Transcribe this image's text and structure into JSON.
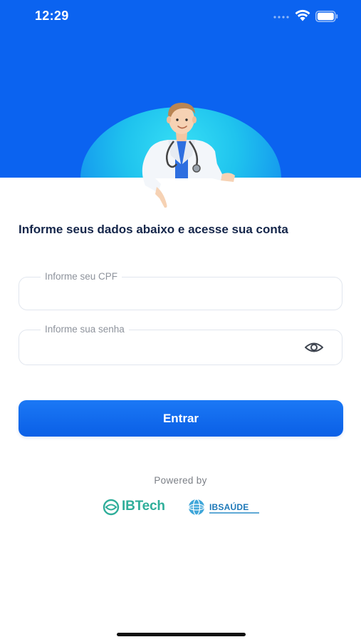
{
  "status_bar": {
    "time": "12:29"
  },
  "login": {
    "headline": "Informe seus dados abaixo e acesse sua conta",
    "cpf_label": "Informe seu CPF",
    "cpf_value": "",
    "password_label": "Informe sua senha",
    "password_value": "",
    "submit_label": "Entrar"
  },
  "footer": {
    "powered_by": "Powered by",
    "brands": [
      "IBTech",
      "IBSAÚDE"
    ]
  },
  "colors": {
    "primary": "#0b63f0",
    "hero_gradient": "#1fc3ee",
    "headline": "#15264a",
    "ibtech": "#2fae9a",
    "ibsaude": "#1d78b8"
  },
  "icons": [
    "cellular-signal-icon",
    "wifi-icon",
    "battery-icon",
    "doctor-illustration",
    "eye-icon",
    "ibtech-logo",
    "ibsaude-logo"
  ]
}
